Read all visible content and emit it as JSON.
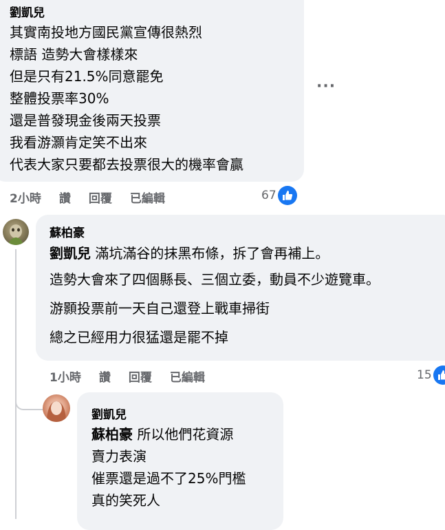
{
  "comment1": {
    "author": "劉凱兒",
    "lines": [
      "其實南投地方國民黨宣傳很熱烈",
      "標語 造勢大會樣樣來",
      "但是只有21.5%同意罷免",
      "整體投票率30%",
      "還是普發現金後兩天投票",
      "我看游灝肯定笑不出來",
      "代表大家只要都去投票很大的機率會贏"
    ],
    "time": "2小時",
    "like": "讚",
    "reply": "回覆",
    "edited": "已編輯",
    "reactions": "67",
    "more": "···"
  },
  "comment2": {
    "author": "蘇柏豪",
    "mention": "劉凱兒",
    "first_line": " 滿坑滿谷的抹黑布條，拆了會再補上。",
    "lines": [
      "造勢大會來了四個縣長、三個立委，動員不少遊覽車。",
      "游顥投票前一天自己還登上戰車掃街",
      "總之已經用力很猛還是罷不掉"
    ],
    "time": "1小時",
    "like": "讚",
    "reply": "回覆",
    "edited": "已編輯",
    "reactions": "15"
  },
  "comment3": {
    "author": "劉凱兒",
    "mention": "蘇柏豪",
    "first_line": " 所以他們花資源",
    "lines": [
      "賣力表演",
      "催票還是過不了25%門檻",
      "真的笑死人"
    ]
  },
  "icons": {
    "like": "thumbs-up-icon",
    "more": "more-options-icon"
  },
  "colors": {
    "bubble": "#f0f2f5",
    "meta": "#65676b",
    "like_blue": "#1877f2"
  }
}
